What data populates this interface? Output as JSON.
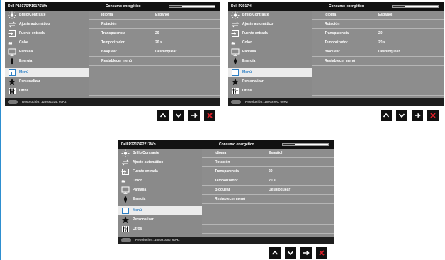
{
  "panels": [
    {
      "model": "Dell P1917S/P1917SWh",
      "energy_label": "Consumo energético",
      "energy_level": 0.28,
      "menu": [
        {
          "label": "Brillo/Contraste",
          "icon": "brightness-icon"
        },
        {
          "label": "Ajuste automático",
          "icon": "auto-adjust-icon"
        },
        {
          "label": "Fuente entrada",
          "icon": "input-source-icon"
        },
        {
          "label": "Color",
          "icon": "color-icon"
        },
        {
          "label": "Pantalla",
          "icon": "display-icon"
        },
        {
          "label": "Energía",
          "icon": "energy-icon"
        },
        {
          "label": "Menú",
          "icon": "menu-icon",
          "selected": true
        },
        {
          "label": "Personalizar",
          "icon": "star-icon"
        },
        {
          "label": "Otros",
          "icon": "others-icon"
        }
      ],
      "rows": [
        {
          "label": "Idioma",
          "value": "Español"
        },
        {
          "label": "Rotación",
          "value": ""
        },
        {
          "label": "Transparencia",
          "value": "20"
        },
        {
          "label": "Temporizador",
          "value": "20 s"
        },
        {
          "label": "Bloquear",
          "value": "Desbloquear"
        },
        {
          "label": "Restablecer menú",
          "value": ""
        },
        {
          "label": "",
          "value": ""
        },
        {
          "label": "",
          "value": ""
        },
        {
          "label": "",
          "value": ""
        }
      ],
      "resolution": "Resolución: 1280x1024, 60Hz"
    },
    {
      "model": "Dell P2017H",
      "energy_label": "Consumo energético",
      "energy_level": 0.28,
      "menu": [
        {
          "label": "Brillo/Contraste",
          "icon": "brightness-icon"
        },
        {
          "label": "Ajuste automático",
          "icon": "auto-adjust-icon"
        },
        {
          "label": "Fuente entrada",
          "icon": "input-source-icon"
        },
        {
          "label": "Color",
          "icon": "color-icon"
        },
        {
          "label": "Pantalla",
          "icon": "display-icon"
        },
        {
          "label": "Energía",
          "icon": "energy-icon"
        },
        {
          "label": "Menú",
          "icon": "menu-icon",
          "selected": true
        },
        {
          "label": "Personalizar",
          "icon": "star-icon"
        },
        {
          "label": "Otros",
          "icon": "others-icon"
        }
      ],
      "rows": [
        {
          "label": "Idioma",
          "value": "Español"
        },
        {
          "label": "Rotación",
          "value": ""
        },
        {
          "label": "Transparencia",
          "value": "20"
        },
        {
          "label": "Temporizador",
          "value": "20 s"
        },
        {
          "label": "Bloquear",
          "value": "Desbloquear"
        },
        {
          "label": "Restablecer menú",
          "value": ""
        },
        {
          "label": "",
          "value": ""
        },
        {
          "label": "",
          "value": ""
        },
        {
          "label": "",
          "value": ""
        }
      ],
      "resolution": "Resolución: 1600x900, 60Hz"
    },
    {
      "model": "Dell P2217/P2217Wh",
      "energy_label": "Consumo energético",
      "energy_level": 0.28,
      "menu": [
        {
          "label": "Brillo/Contraste",
          "icon": "brightness-icon"
        },
        {
          "label": "Ajuste automático",
          "icon": "auto-adjust-icon"
        },
        {
          "label": "Fuente entrada",
          "icon": "input-source-icon"
        },
        {
          "label": "Color",
          "icon": "color-icon"
        },
        {
          "label": "Pantalla",
          "icon": "display-icon"
        },
        {
          "label": "Energía",
          "icon": "energy-icon"
        },
        {
          "label": "Menú",
          "icon": "menu-icon",
          "selected": true
        },
        {
          "label": "Personalizar",
          "icon": "star-icon"
        },
        {
          "label": "Otros",
          "icon": "others-icon"
        }
      ],
      "rows": [
        {
          "label": "Idioma",
          "value": "Español"
        },
        {
          "label": "Rotación",
          "value": ""
        },
        {
          "label": "Transparencia",
          "value": "20"
        },
        {
          "label": "Temporizador",
          "value": "20 s"
        },
        {
          "label": "Bloquear",
          "value": "Desbloquear"
        },
        {
          "label": "Restablecer menú",
          "value": ""
        },
        {
          "label": "",
          "value": ""
        },
        {
          "label": "",
          "value": ""
        },
        {
          "label": "",
          "value": ""
        }
      ],
      "resolution": "Resolución: 1680x1050, 60Hz"
    }
  ],
  "buttons": [
    {
      "name": "up-button",
      "icon": "chevron-up-icon"
    },
    {
      "name": "down-button",
      "icon": "chevron-down-icon"
    },
    {
      "name": "ok-button",
      "icon": "arrow-right-icon"
    },
    {
      "name": "exit-button",
      "icon": "close-icon"
    }
  ],
  "colors": {
    "selected_text": "#2d7fc4",
    "exit_icon": "#e0202a",
    "accent_bar": "#2e8fd0"
  }
}
